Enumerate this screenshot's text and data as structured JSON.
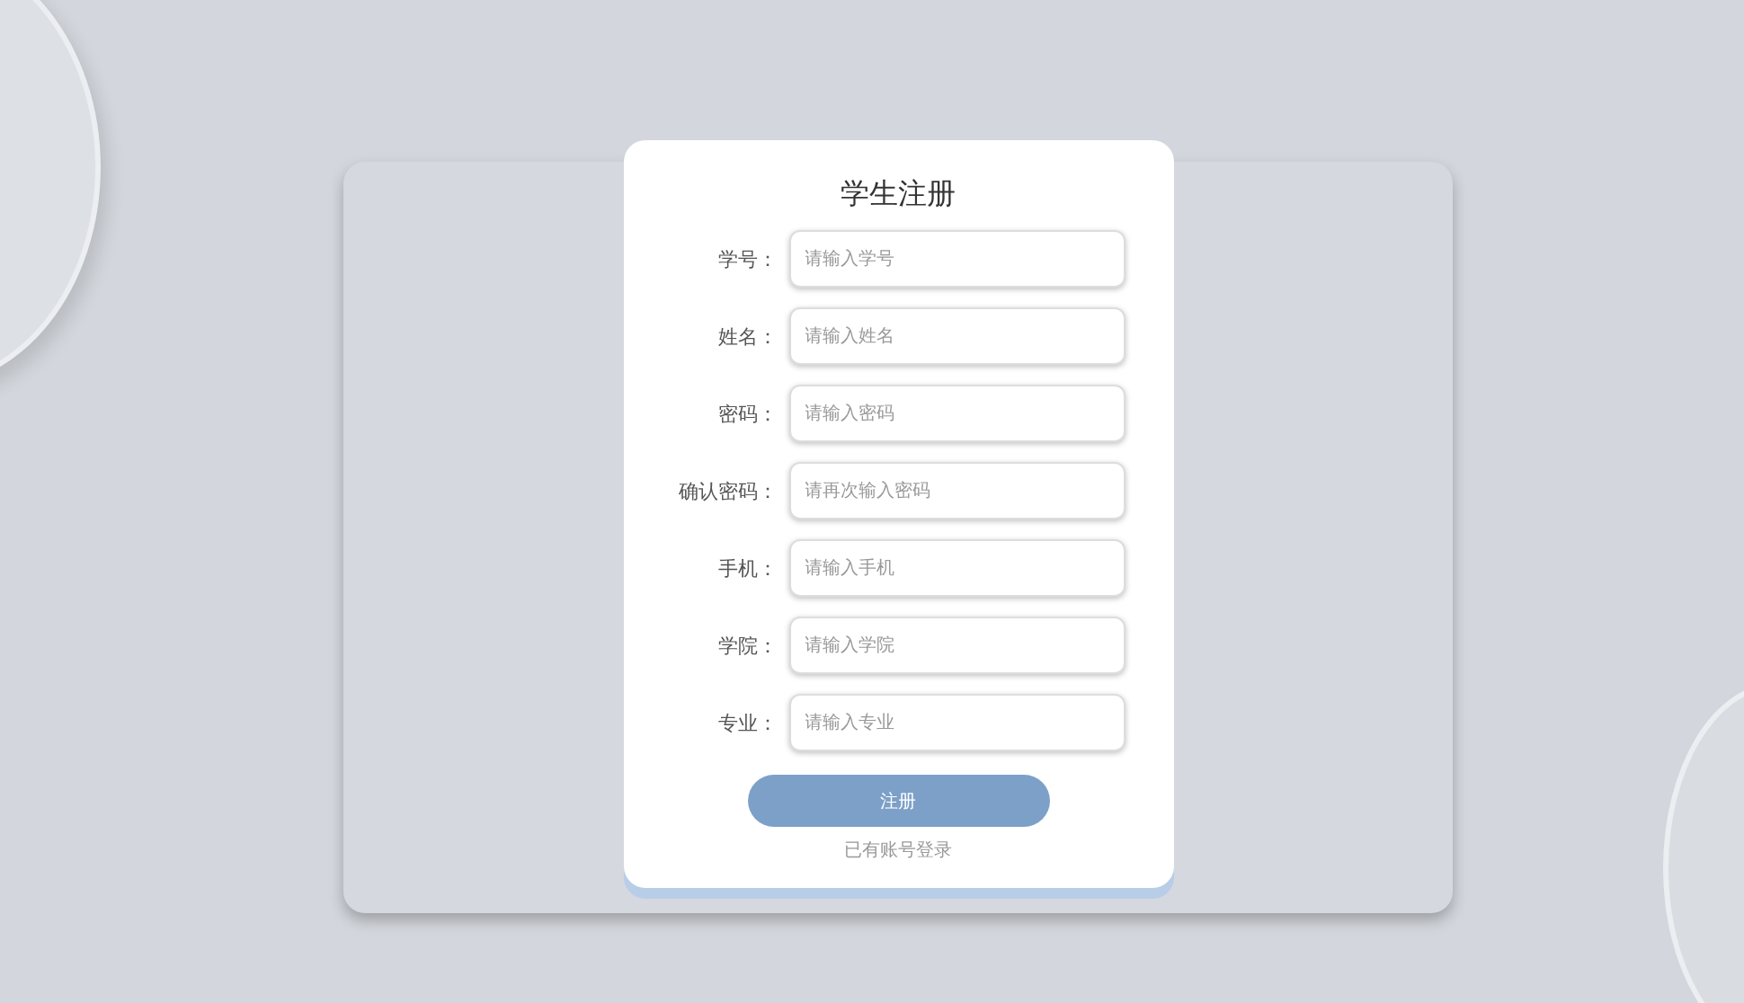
{
  "form": {
    "title": "学生注册",
    "fields": [
      {
        "label": "学号：",
        "placeholder": "请输入学号"
      },
      {
        "label": "姓名：",
        "placeholder": "请输入姓名"
      },
      {
        "label": "密码：",
        "placeholder": "请输入密码"
      },
      {
        "label": "确认密码：",
        "placeholder": "请再次输入密码"
      },
      {
        "label": "手机：",
        "placeholder": "请输入手机"
      },
      {
        "label": "学院：",
        "placeholder": "请输入学院"
      },
      {
        "label": "专业：",
        "placeholder": "请输入专业"
      }
    ],
    "submit": "注册",
    "login_link": "已有账号登录"
  }
}
